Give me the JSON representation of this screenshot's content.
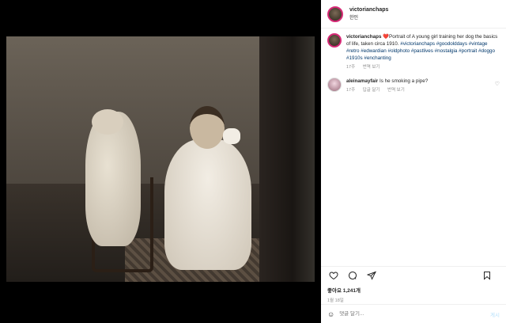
{
  "header": {
    "username": "victorianchaps",
    "subtitle": "한인"
  },
  "caption": {
    "username": "victorianchaps",
    "emoji": "❤️",
    "text": "Portrait of A young girl training her dog the basics of life, taken circa 1910.",
    "hashtags": "#victorianchaps #goodolddays #vintage #retro #edwardian #oldphoto #pastlives #nostalgia #portrait #doggo #1910s #enchanting",
    "time": "17주",
    "see_translation": "번역 보기"
  },
  "comments": [
    {
      "username": "aleinamayfair",
      "text": "Is he smoking a pipe?",
      "time": "17주",
      "reply": "답글 달기",
      "see_translation": "번역 보기"
    }
  ],
  "actions": {
    "likes": "좋아요 1,241개",
    "date": "1월 18일"
  },
  "add_comment": {
    "placeholder": "댓글 달기...",
    "post_label": "게시"
  },
  "icons": [
    "heart-icon",
    "comment-icon",
    "share-icon",
    "bookmark-icon",
    "emoji-icon",
    "like-comment-icon"
  ],
  "colors": {
    "avatar_ring": "#d62976",
    "hashtag": "#00376b",
    "meta": "#8e8e8e"
  }
}
